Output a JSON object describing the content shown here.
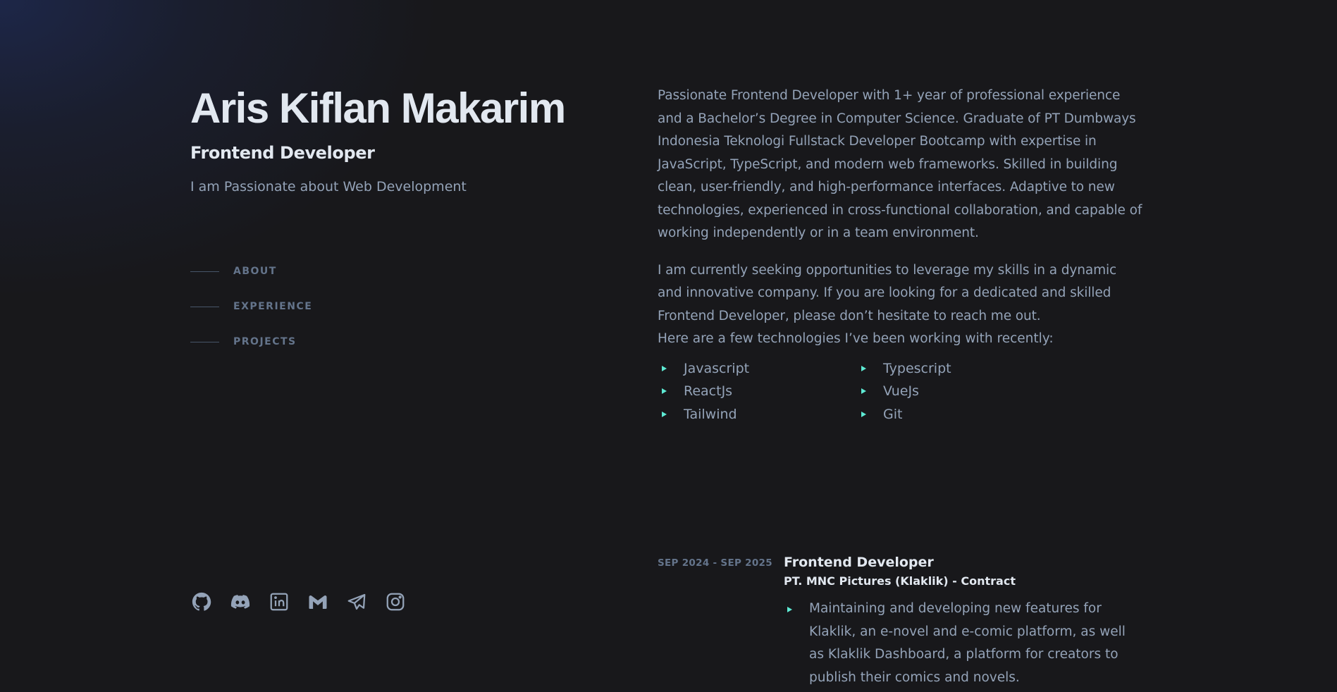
{
  "header": {
    "name": "Aris Kiflan Makarim",
    "role": "Frontend Developer",
    "tagline": "I am Passionate about Web Development"
  },
  "nav": {
    "items": [
      {
        "label": "ABOUT"
      },
      {
        "label": "EXPERIENCE"
      },
      {
        "label": "PROJECTS"
      }
    ]
  },
  "socials": [
    {
      "icon": "github-icon"
    },
    {
      "icon": "discord-icon"
    },
    {
      "icon": "linkedin-icon"
    },
    {
      "icon": "gmail-icon"
    },
    {
      "icon": "telegram-icon"
    },
    {
      "icon": "instagram-icon"
    }
  ],
  "about": {
    "paragraph1": "Passionate Frontend Developer with 1+ year of professional experience and a Bachelor’s Degree in Computer Science. Graduate of PT Dumbways Indonesia Teknologi Fullstack Developer Bootcamp with expertise in JavaScript, TypeScript, and modern web frameworks. Skilled in building clean, user-friendly, and high-performance interfaces. Adaptive to new technologies, experienced in cross-functional collaboration, and capable of working independently or in a team environment.",
    "paragraph2": "I am currently seeking opportunities to leverage my skills in a dynamic and innovative company. If you are looking for a dedicated and skilled Frontend Developer, please don’t hesitate to reach me out.",
    "tech_intro": "Here are a few technologies I’ve been working with recently:",
    "technologies": [
      "Javascript",
      "Typescript",
      "ReactJs",
      "VueJs",
      "Tailwind",
      "Git"
    ]
  },
  "experience": [
    {
      "date": "SEP 2024 - SEP 2025",
      "title": "Frontend Developer",
      "company": "PT. MNC Pictures (Klaklik) - Contract",
      "points": [
        "Maintaining and developing new features for Klaklik, an e-novel and e-comic platform, as well as Klaklik Dashboard, a platform for creators to publish their comics and novels."
      ]
    }
  ],
  "colors": {
    "background": "#18181b",
    "heading": "#e2e8f0",
    "body_text": "#94a3b8",
    "muted": "#64748b",
    "accent": "#5eead4",
    "glow": "#1e2950"
  }
}
